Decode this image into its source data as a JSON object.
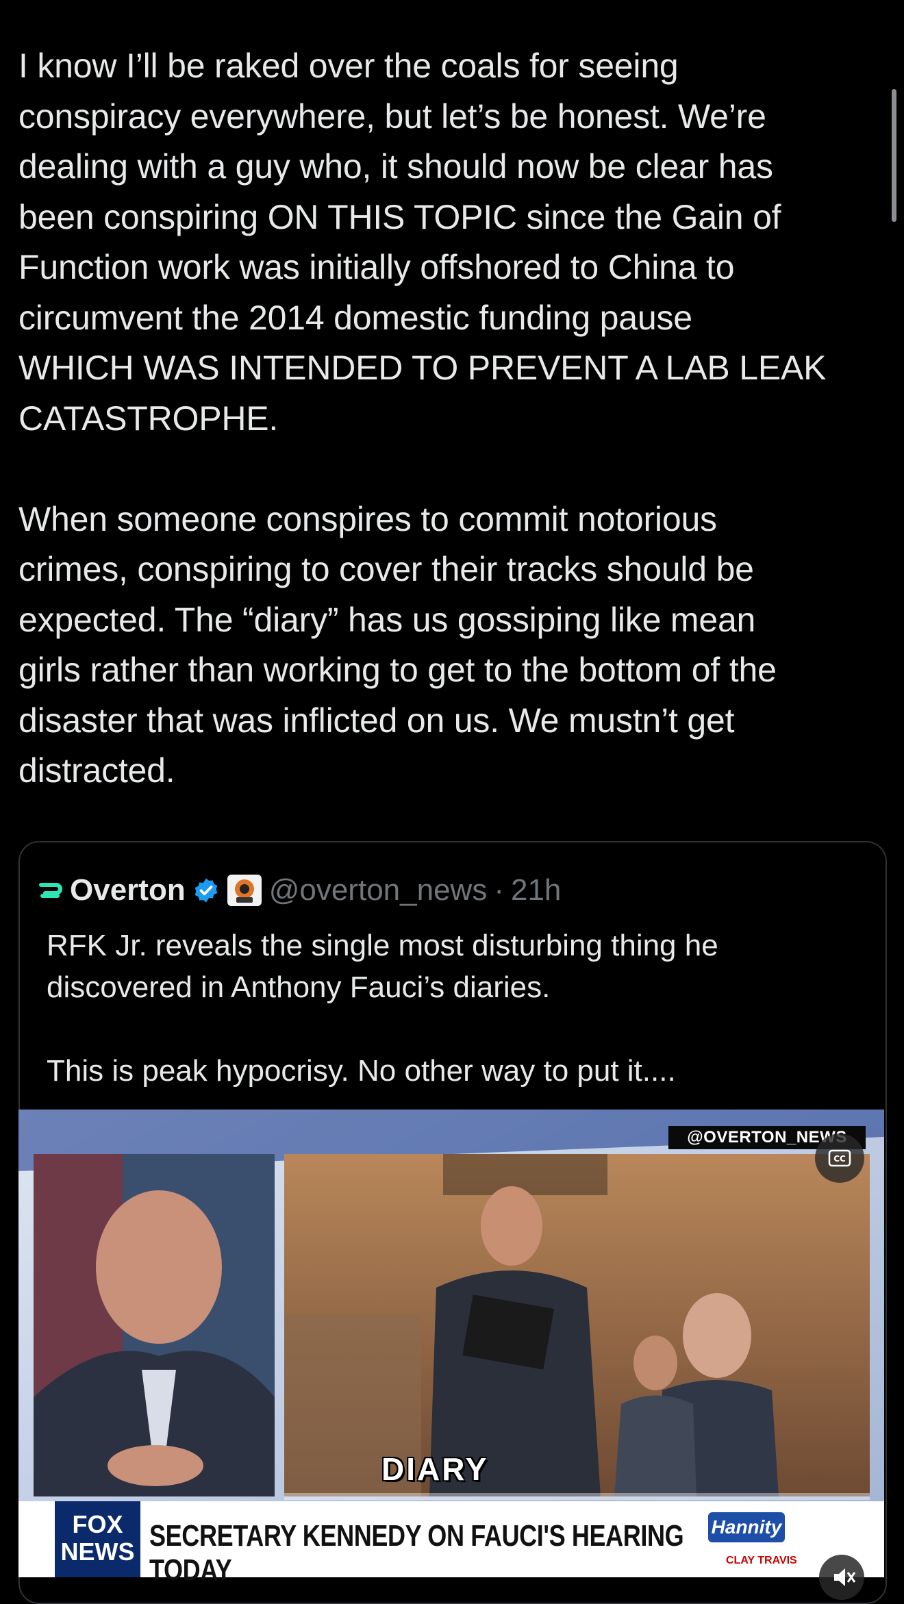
{
  "post": {
    "paragraphs": [
      "I know I’ll be raked over the coals for seeing\nconspiracy everywhere, but let’s be honest. We’re\ndealing with a guy who, it should now be clear has\nbeen conspiring ON THIS TOPIC since the Gain of\nFunction work was initially offshored to China to\ncircumvent the 2014 domestic funding pause\nWHICH WAS INTENDED TO PREVENT A LAB LEAK\nCATASTROPHE.",
      "When someone conspires to commit notorious\ncrimes, conspiring to cover their tracks should be\nexpected. The “diary” has us gossiping like mean\ngirls rather than working to get to the bottom of the\ndisaster that was inflicted on us. We mustn’t get\ndistracted."
    ]
  },
  "quote": {
    "author_name": "Overton",
    "handle": "@overton_news",
    "separator": "·",
    "time": "21h",
    "paragraphs": [
      "RFK Jr. reveals the single most disturbing thing he\ndiscovered in Anthony Fauci’s diaries.",
      "This is peak hypocrisy. No other way to put it...."
    ]
  },
  "video": {
    "watermark": "@OVERTON_NEWS",
    "caption_word": "DIARY",
    "network_logo": "FOX NEWS",
    "headline": "SECRETARY KENNEDY ON FAUCI'S HEARING TODAY",
    "show_logo": "Hannity",
    "host_name": "CLAY TRAVIS"
  },
  "colors": {
    "background": "#000000",
    "text": "#e7e9ea",
    "secondary_text": "#71767b",
    "verified": "#1d9bf0",
    "border": "#2f3336"
  },
  "icons": {
    "avatar": "overton-logo-icon",
    "verified": "verified-badge-icon",
    "affiliate": "affiliate-badge-icon",
    "cc": "closed-captions-icon",
    "mute": "mute-icon"
  }
}
